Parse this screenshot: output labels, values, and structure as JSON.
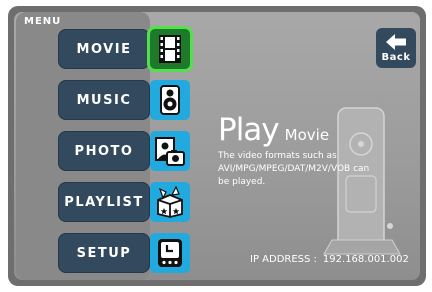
{
  "menu": {
    "title": "MENU",
    "items": [
      {
        "label": "MOVIE",
        "icon": "film-strip-icon",
        "selected": true
      },
      {
        "label": "MUSIC",
        "icon": "speaker-icon",
        "selected": false
      },
      {
        "label": "PHOTO",
        "icon": "photo-camera-icon",
        "selected": false
      },
      {
        "label": "PLAYLIST",
        "icon": "playlist-box-icon",
        "selected": false
      },
      {
        "label": "SETUP",
        "icon": "clock-setup-icon",
        "selected": false
      }
    ]
  },
  "back": {
    "label": "Back",
    "icon": "back-arrow-icon"
  },
  "info": {
    "title": "Play",
    "subtitle": "Movie",
    "description": "The video formats such as AVI/MPG/MPEG/DAT/M2V/VOB can be played."
  },
  "status": {
    "ip_label": "IP ADDRESS :",
    "ip_value": "192.168.001.002"
  },
  "colors": {
    "button": "#33495d",
    "icon_box": "#22a9de",
    "selected_border": "#53e04c",
    "background": "#9e9e9e"
  }
}
